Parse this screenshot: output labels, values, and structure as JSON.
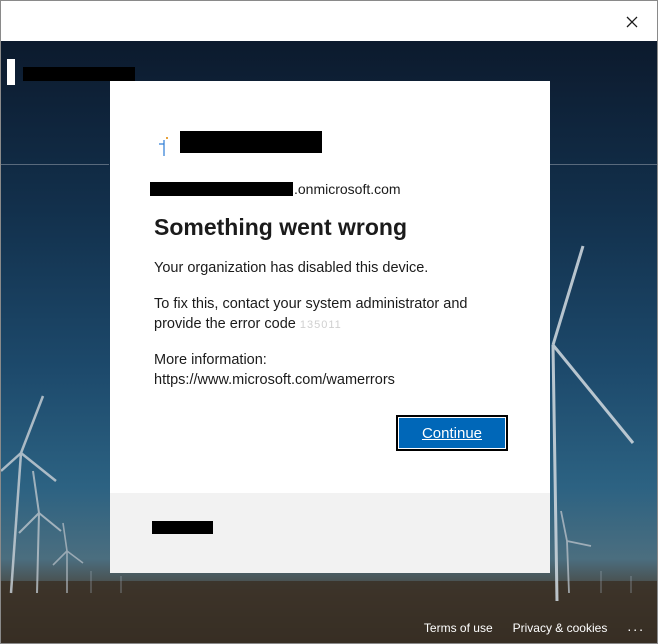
{
  "window": {
    "close_icon": "close-icon"
  },
  "dialog": {
    "account_suffix": ".onmicrosoft.com",
    "heading": "Something went wrong",
    "message_disabled": "Your organization has disabled this device.",
    "message_fix": "To fix this, contact your system administrator and provide the error code",
    "error_code": "135011",
    "more_info_label": "More information:",
    "more_info_url": "https://www.microsoft.com/wamerrors",
    "continue_label": "Continue"
  },
  "footer": {
    "terms_label": "Terms of use",
    "privacy_label": "Privacy & cookies",
    "more_label": "..."
  },
  "colors": {
    "button_primary": "#0067b8",
    "footer_bg": "#f2f2f2",
    "text": "#1b1b1b"
  }
}
